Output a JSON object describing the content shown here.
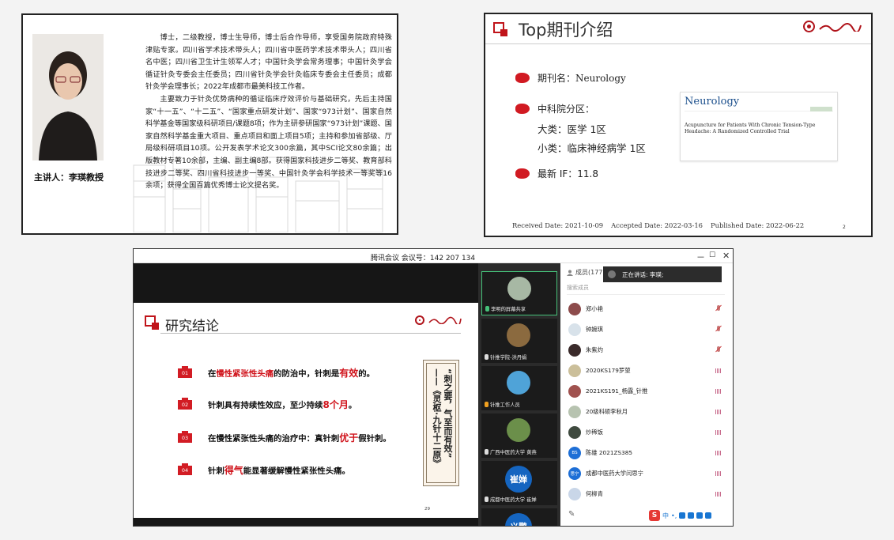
{
  "slide1": {
    "speaker_label": "主讲人：李瑛教授",
    "bio_paragraphs": [
      "博士，二级教授，博士生导师，博士后合作导师，享受国务院政府特殊津贴专家。四川省学术技术带头人；四川省中医药学术技术带头人；四川省名中医；四川省卫生计生领军人才；中国针灸学会常务理事；中国针灸学会循证针灸专委会主任委员；四川省针灸学会针灸临床专委会主任委员；成都针灸学会理事长；2022年成都市最美科技工作者。",
      "主要致力于针灸优势病种的循证临床疗效评价与基础研究，先后主持国家“十一五”、“十二五”、“国家重点研发计划”、国家“973计划”、国家自然科学基金等国家级科研项目/课题8项；作为主研参研国家“973计划”课题、国家自然科学基金重大项目、重点项目和面上项目5项；主持和参加省部级、厅局级科研项目10项。公开发表学术论文300余篇，其中SCI论文80余篇；出版教材专著10余部，主编、副主编8部。获得国家科技进步二等奖、教育部科技进步二等奖、四川省科技进步一等奖、中国针灸学会科学技术一等奖等16余项；获得全国百篇优秀博士论文提名奖。"
    ]
  },
  "slide2": {
    "title": "Top期刊介绍",
    "journal_label": "期刊名：",
    "journal_name": "Neurology",
    "zone_label": "中科院分区：",
    "major_label": "大类：医学 1区",
    "minor_label": "小类：临床神经病学 1区",
    "if_label": "最新 IF：",
    "if_value": "11.8",
    "card_logo": "Neurology",
    "card_article_title": "Acupuncture for Patients With Chronic Tension-Type Headache: A Randomized Controlled Trial",
    "dates": [
      "Received Date: 2021-10-09",
      "Accepted Date: 2022-03-16",
      "Published Date: 2022-06-22"
    ],
    "page_number": "2"
  },
  "meeting": {
    "window_title": "腾讯会议 会议号：142 207 134",
    "controls": [
      "－",
      "☐",
      "✕"
    ],
    "slide": {
      "title": "研究结论",
      "rows": [
        {
          "num": "01",
          "pre": "在",
          "hl": "慢性紧张性头痛",
          "mid": "的防治中，针刺是",
          "hl2": "有效",
          "post": "的。"
        },
        {
          "num": "02",
          "pre": "针刺具有持续性效应，至少持续",
          "hl": "8个月",
          "mid": "。",
          "hl2": "",
          "post": ""
        },
        {
          "num": "03",
          "pre": "在慢性紧张性头痛的治疗中：真针刺",
          "hl": "优于",
          "mid": "假针刺。",
          "hl2": "",
          "post": ""
        },
        {
          "num": "04",
          "pre": "针刺",
          "hl": "得气",
          "mid": "能显著缓解慢性紧张性头痛。",
          "hl2": "",
          "post": ""
        }
      ],
      "quote_col1": "“刺之要，气至而有效”",
      "quote_col2": "——《灵枢·九针十二原》",
      "page_number": "29"
    },
    "video_tiles": [
      {
        "name": "李明的屏幕共享",
        "avatar": ""
      },
      {
        "name": "针推学院-洪丹娟",
        "avatar": ""
      },
      {
        "name": "针推工作人员",
        "avatar": ""
      },
      {
        "name": "广西中医药大学 黄燕",
        "avatar": ""
      },
      {
        "name": "成都中医药大学 崔婵",
        "avatar": "崔婵"
      },
      {
        "name": "",
        "avatar": "义鹏"
      }
    ],
    "panel": {
      "header": "成员(177)",
      "speaking_text": "正在讲话: 李瑛;",
      "search_placeholder": "搜索成员",
      "members": [
        {
          "name": "郑小艳",
          "mic": "muted",
          "av": ""
        },
        {
          "name": "钟婉琪",
          "mic": "muted",
          "av": ""
        },
        {
          "name": "朱紫灼",
          "mic": "muted",
          "av": ""
        },
        {
          "name": "2020KS179罗堃",
          "mic": "bars",
          "av": ""
        },
        {
          "name": "2021KS191_杨露_针推",
          "mic": "bars",
          "av": ""
        },
        {
          "name": "20级科硕李秋月",
          "mic": "bars",
          "av": ""
        },
        {
          "name": "炒稀饭",
          "mic": "bars",
          "av": ""
        },
        {
          "name": "陈雄 2021ZS385",
          "mic": "bars",
          "av": "BS"
        },
        {
          "name": "成都中医药大学闫思宁",
          "mic": "bars",
          "av": "思宁"
        },
        {
          "name": "何柳青",
          "mic": "bars",
          "av": ""
        }
      ]
    },
    "ime_label": "中"
  }
}
